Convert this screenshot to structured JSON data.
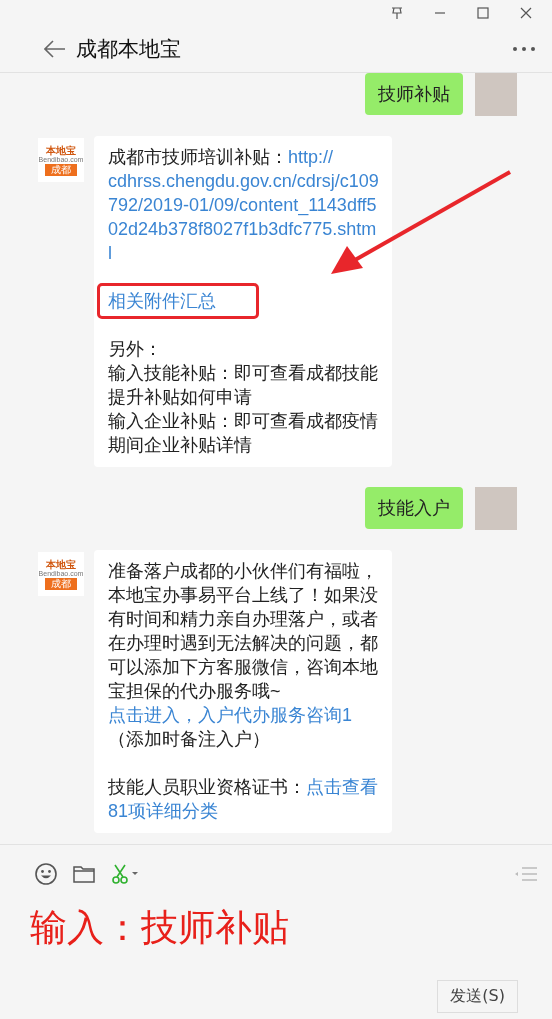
{
  "header": {
    "title": "成都本地宝"
  },
  "messages": [
    {
      "kind": "sent",
      "text": "技师补贴"
    },
    {
      "kind": "received",
      "logo": {
        "brand": "本地宝",
        "site": "Bendibao.com",
        "city": "成都"
      },
      "arrow": true,
      "paragraphs": [
        {
          "highlighted": false,
          "lines": [
            [
              {
                "text": "成都市技师培训补贴：",
                "link": false
              },
              {
                "text": "http://",
                "link": true
              }
            ],
            [
              {
                "text": "cdhrss.chengdu.gov.cn/cdrsj/c109792/2019-01/09/content_1143dff502d24b378f8027f1b3dfc775.shtml",
                "link": true
              }
            ]
          ]
        },
        {
          "highlighted": true,
          "lines": [
            [
              {
                "text": "相关附件汇总",
                "link": true
              }
            ]
          ]
        },
        {
          "highlighted": false,
          "lines": [
            [
              {
                "text": "另外：",
                "link": false
              }
            ],
            [
              {
                "text": "输入技能补贴：即可查看成都技能提升补贴如何申请",
                "link": false
              }
            ],
            [
              {
                "text": "输入企业补贴：即可查看成都疫情期间企业补贴详情",
                "link": false
              }
            ]
          ]
        }
      ]
    },
    {
      "kind": "sent",
      "text": "技能入户"
    },
    {
      "kind": "received",
      "logo": {
        "brand": "本地宝",
        "site": "Bendibao.com",
        "city": "成都"
      },
      "arrow": false,
      "paragraphs": [
        {
          "highlighted": false,
          "lines": [
            [
              {
                "text": "准备落户成都的小伙伴们有福啦，本地宝办事易平台上线了！如果没有时间和精力亲自办理落户，或者在办理时遇到无法解决的问题，都可以添加下方客服微信，咨询本地宝担保的代办服务哦~",
                "link": false
              }
            ],
            [
              {
                "text": "点击进入，入户代办服务咨询1",
                "link": true
              },
              {
                "text": "（添加时备注入户）",
                "link": false
              }
            ]
          ]
        },
        {
          "highlighted": false,
          "lines": [
            [
              {
                "text": "技能人员职业资格证书：",
                "link": false
              },
              {
                "text": "点击查看",
                "link": true
              }
            ],
            [
              {
                "text": "81项详细分类",
                "link": true
              }
            ]
          ]
        }
      ]
    }
  ],
  "composer": {
    "value": "输入：技师补贴",
    "send": "发送(S)"
  }
}
